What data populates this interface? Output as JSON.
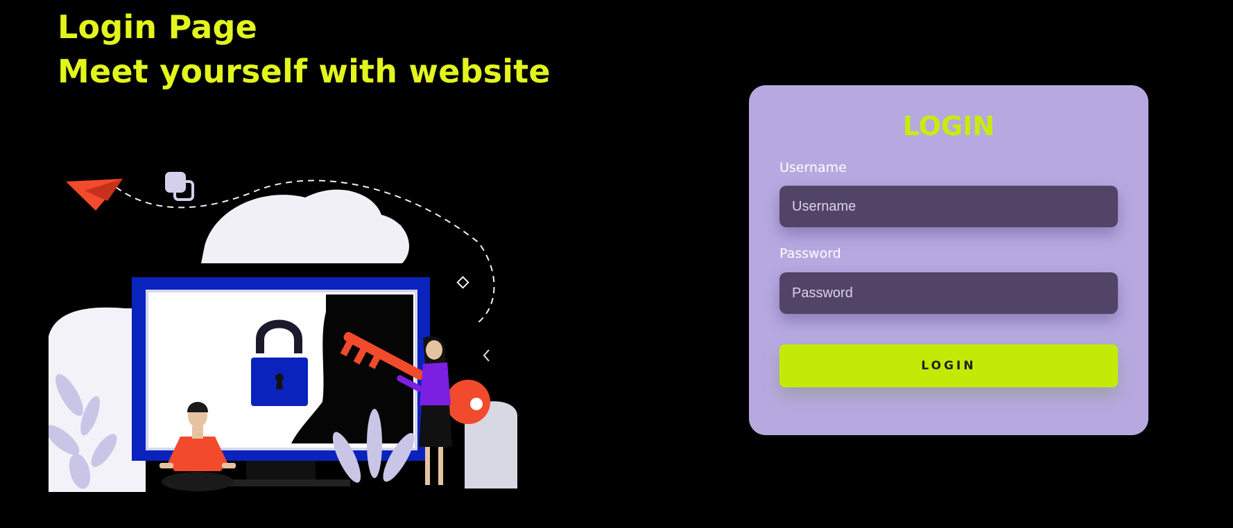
{
  "header": {
    "title": "Login Page",
    "subtitle": "Meet yourself with website"
  },
  "illustration": {
    "name": "login-security-illustration"
  },
  "login_form": {
    "title": "LOGIN",
    "username_label": "Username",
    "username_placeholder": "Username",
    "username_value": "",
    "password_label": "Password",
    "password_placeholder": "Password",
    "password_value": "",
    "submit_label": "LOGIN"
  },
  "colors": {
    "background": "#000000",
    "heading": "#e2f51c",
    "card": "#b7a9e0",
    "card_title": "#c8ec0a",
    "input_bg": "#524466",
    "button": "#c3ea07",
    "button_text": "#222222"
  }
}
